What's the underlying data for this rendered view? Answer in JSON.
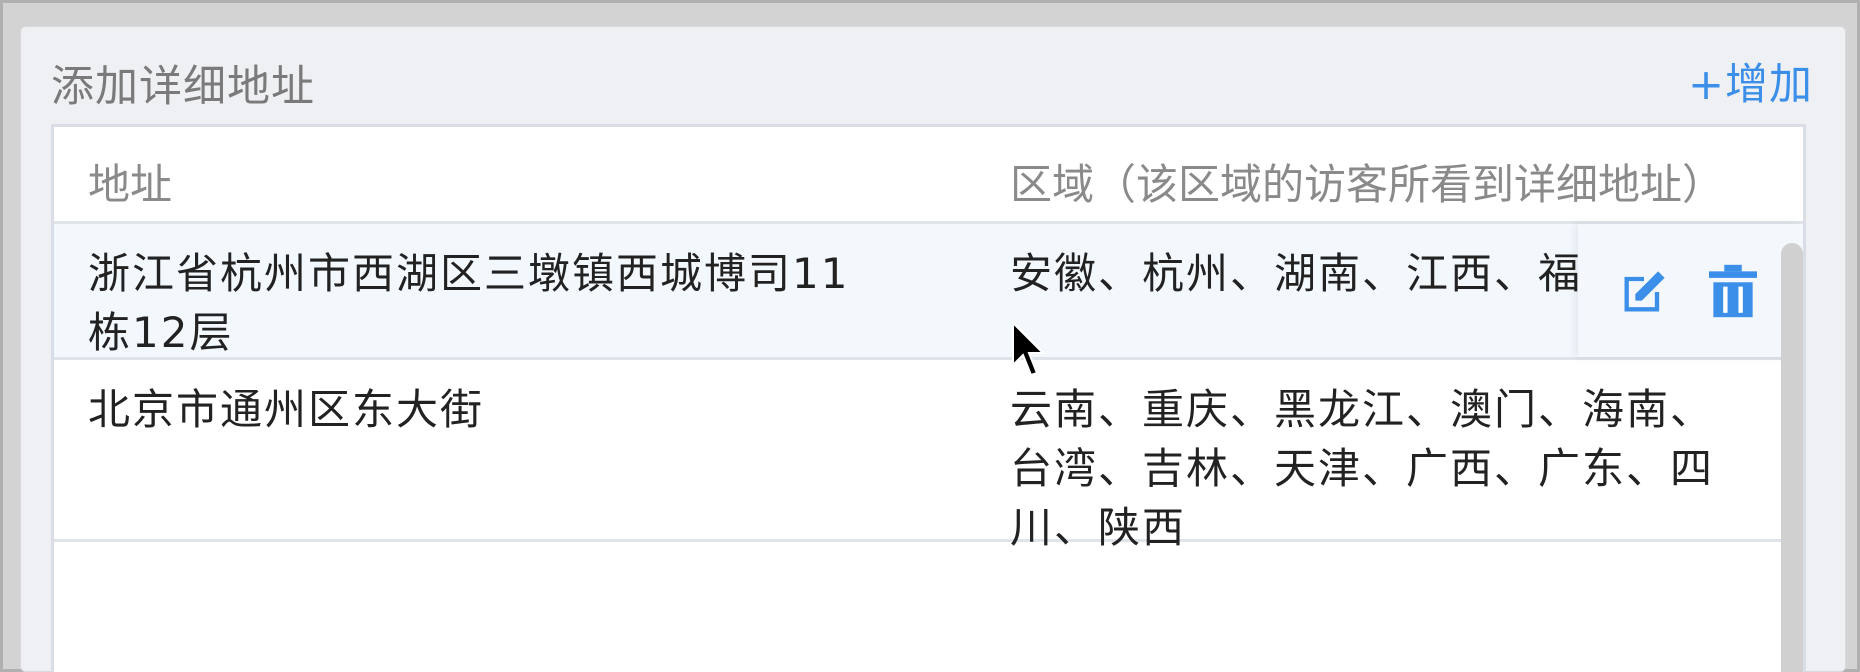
{
  "section": {
    "title": "添加详细地址",
    "add_label": "+增加"
  },
  "table": {
    "columns": {
      "address": "地址",
      "region": "区域（该区域的访客所看到详细地址）"
    },
    "rows": [
      {
        "address": "浙江省杭州市西湖区三墩镇西城博司11栋12层",
        "region": "安徽、杭州、湖南、江西、福"
      },
      {
        "address": "北京市通州区东大街",
        "region": "云南、重庆、黑龙江、澳门、海南、台湾、吉林、天津、广西、广东、四川、陕西"
      }
    ]
  },
  "icons": {
    "edit": "edit-icon",
    "delete": "trash-icon",
    "cursor": "mouse-pointer"
  },
  "colors": {
    "accent": "#3b8fe8",
    "hover_row": "#f3f8fd"
  }
}
